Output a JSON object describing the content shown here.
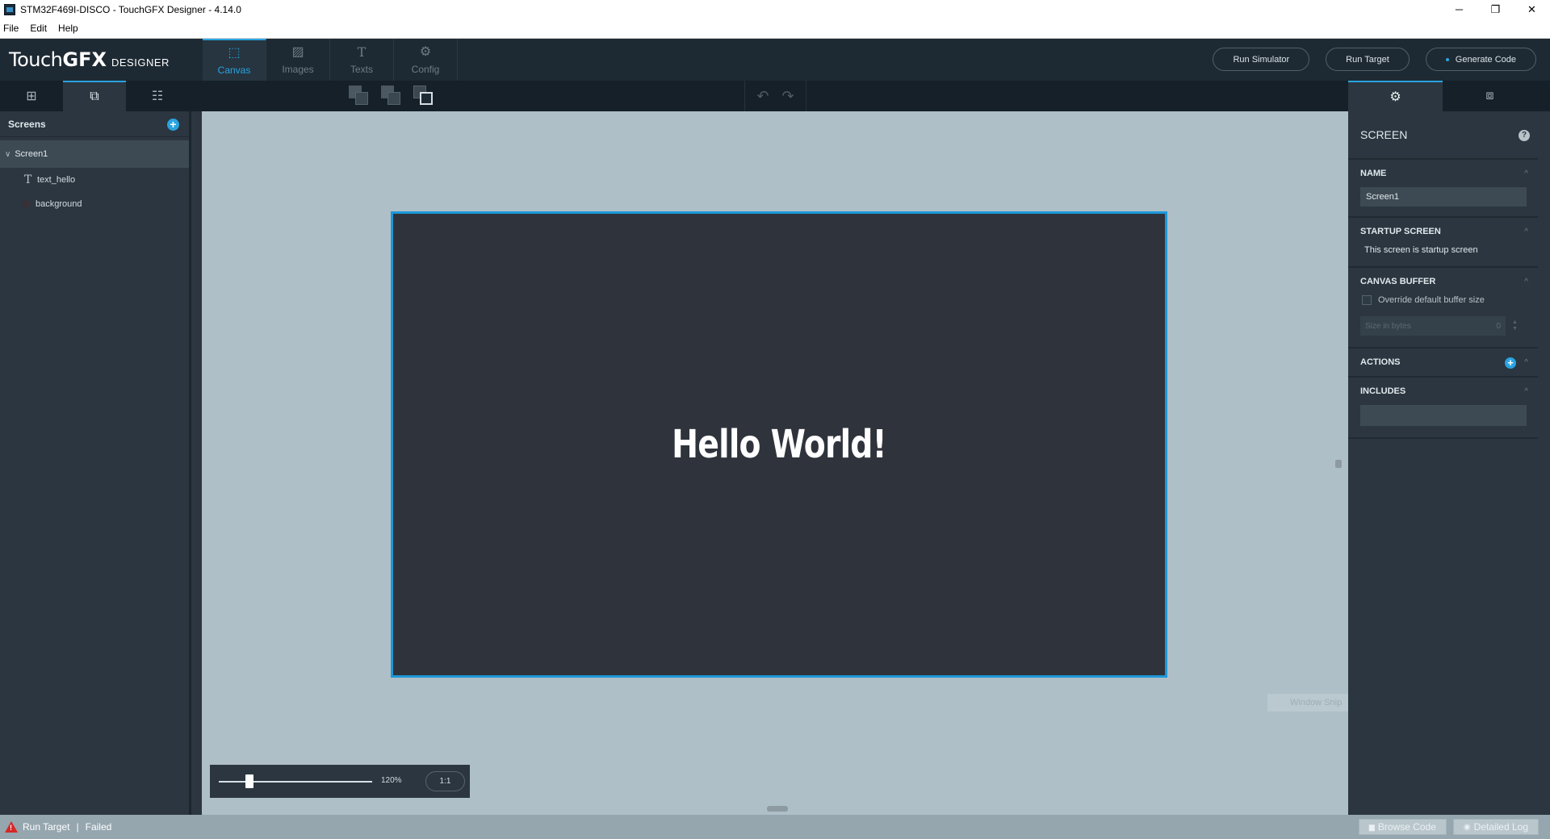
{
  "window": {
    "title": "STM32F469I-DISCO - TouchGFX Designer - 4.14.0",
    "controls": {
      "minimize": "─",
      "restore": "❐",
      "close": "✕"
    }
  },
  "menu": [
    "File",
    "Edit",
    "Help"
  ],
  "logo": {
    "part1": "Touch",
    "part2": "GFX",
    "part3": "DESIGNER"
  },
  "nav_tabs": [
    {
      "label": "Canvas",
      "icon": "canvas-icon",
      "glyph": "⬚",
      "active": true
    },
    {
      "label": "Images",
      "icon": "image-icon",
      "glyph": "▨",
      "active": false
    },
    {
      "label": "Texts",
      "icon": "text-icon",
      "glyph": "T",
      "active": false
    },
    {
      "label": "Config",
      "icon": "gear-icon",
      "glyph": "⚙",
      "active": false
    }
  ],
  "header_buttons": {
    "run_simulator": "Run Simulator",
    "run_target": "Run Target",
    "generate_code": "Generate Code"
  },
  "toolbar": {
    "left_tabs": [
      {
        "icon": "add-widget-icon",
        "glyph": "⊞",
        "active": false
      },
      {
        "icon": "screen-tree-icon",
        "glyph": "⧉",
        "active": true
      },
      {
        "icon": "sliders-icon",
        "glyph": "☷",
        "active": false
      }
    ],
    "undo_glyph": "↶",
    "redo_glyph": "↷",
    "right_tabs": [
      {
        "icon": "screen-properties-icon",
        "glyph": "⚙",
        "active": true
      },
      {
        "icon": "interactions-icon",
        "glyph": "⧈",
        "active": false
      }
    ]
  },
  "screens_panel": {
    "title": "Screens",
    "add_glyph": "+",
    "screen": {
      "name": "Screen1",
      "chevron": "∨"
    },
    "widgets": [
      {
        "name": "text_hello",
        "type": "text",
        "glyph": "T"
      },
      {
        "name": "background",
        "type": "box"
      }
    ]
  },
  "canvas": {
    "text": "Hello World!",
    "zoom_level": "120%",
    "zoom_fraction": 0.2,
    "zoom_reset_label": "1:1",
    "frame_color": "#1d98d9",
    "screen_bg": "#2f333c",
    "ghost_overlay": "Window Snip"
  },
  "properties": {
    "title": "SCREEN",
    "help_glyph": "?",
    "name_label": "NAME",
    "name_value": "Screen1",
    "startup_label": "STARTUP SCREEN",
    "startup_text": "This screen is startup screen",
    "canvas_buffer_label": "CANVAS BUFFER",
    "override_label": "Override default buffer size",
    "size_placeholder": "Size in bytes",
    "size_value": "0",
    "actions_label": "ACTIONS",
    "includes_label": "INCLUDES",
    "collapse_glyph": "^",
    "add_glyph": "+"
  },
  "status": {
    "warn_glyph": "!",
    "action": "Run Target",
    "separator": "|",
    "result": "Failed",
    "browse_code": "Browse Code",
    "detailed_log": "Detailed Log",
    "browse_glyph": "▆",
    "log_glyph": "◉"
  },
  "colors": {
    "accent": "#2aa3e0",
    "error": "#d62828"
  }
}
